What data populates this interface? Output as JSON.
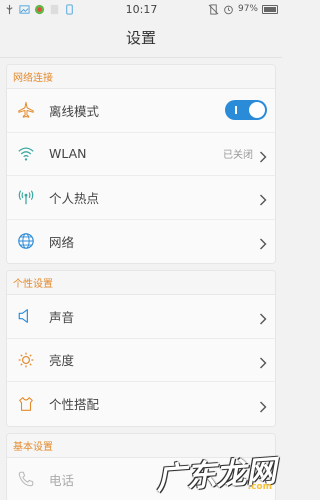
{
  "status_bar": {
    "time": "10:17",
    "battery": "97%",
    "battery_level": 0.97
  },
  "title": "设置",
  "sections": [
    {
      "header": "网络连接",
      "items": [
        {
          "label": "离线模式",
          "icon": "airplane-icon",
          "control": "toggle",
          "on": true
        },
        {
          "label": "WLAN",
          "icon": "wifi-icon",
          "value": "已关闭"
        },
        {
          "label": "个人热点",
          "icon": "hotspot-icon"
        },
        {
          "label": "网络",
          "icon": "globe-icon"
        }
      ]
    },
    {
      "header": "个性设置",
      "items": [
        {
          "label": "声音",
          "icon": "speaker-icon"
        },
        {
          "label": "亮度",
          "icon": "sun-icon"
        },
        {
          "label": "个性搭配",
          "icon": "theme-icon"
        }
      ]
    },
    {
      "header": "基本设置",
      "items": [
        {
          "label": "电话",
          "icon": "phone-icon"
        }
      ]
    }
  ],
  "watermark": {
    "text": "广东龙网",
    "sub": ".com"
  },
  "colors": {
    "accent": "#2a8bd8",
    "section_header": "#e38a2c",
    "icon_orange": "#e38a2c",
    "icon_teal": "#3aa8a0",
    "icon_blue": "#2a8bd8"
  }
}
